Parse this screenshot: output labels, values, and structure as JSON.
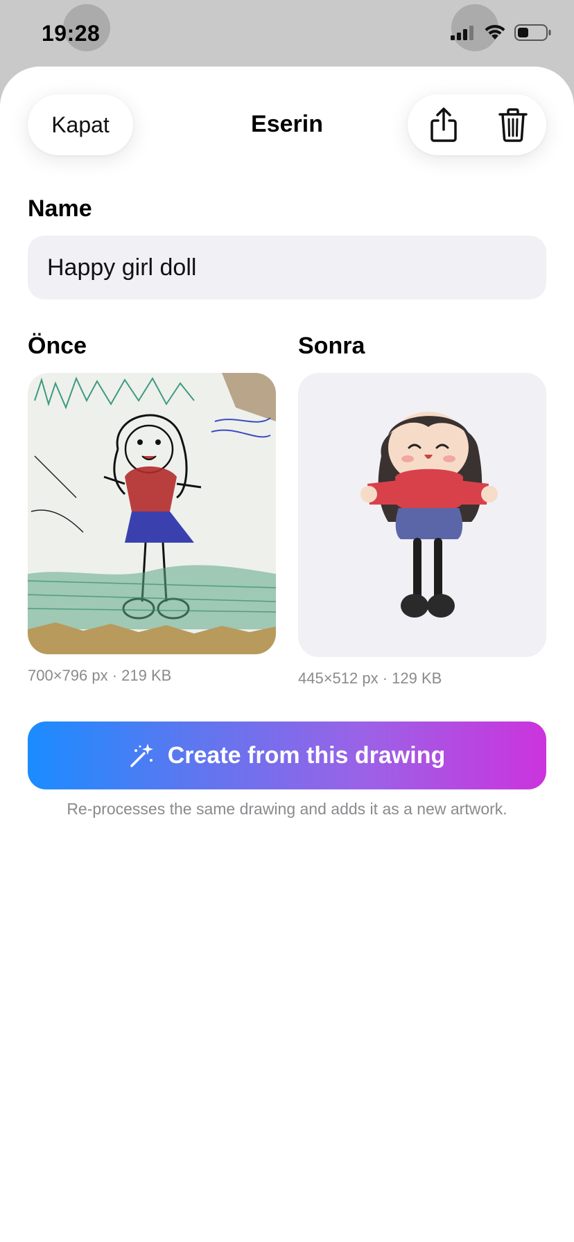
{
  "status_bar": {
    "time": "19:28"
  },
  "sheet": {
    "close_label": "Kapat",
    "title": "Eserin",
    "share_icon": "share-icon",
    "trash_icon": "trash-icon"
  },
  "name_section": {
    "label": "Name",
    "value": "Happy girl doll"
  },
  "before": {
    "label": "Önce",
    "meta": "700×796 px · 219 KB"
  },
  "after": {
    "label": "Sonra",
    "meta": "445×512 px · 129 KB"
  },
  "create": {
    "label": "Create from this drawing",
    "icon": "magic-wand-icon",
    "hint": "Re-processes the same drawing and adds it as a new artwork."
  },
  "colors": {
    "gradient_start": "#1a8cff",
    "gradient_end": "#cc33dd",
    "field_bg": "#f0f0f5",
    "meta_text": "#8a8a8e"
  }
}
